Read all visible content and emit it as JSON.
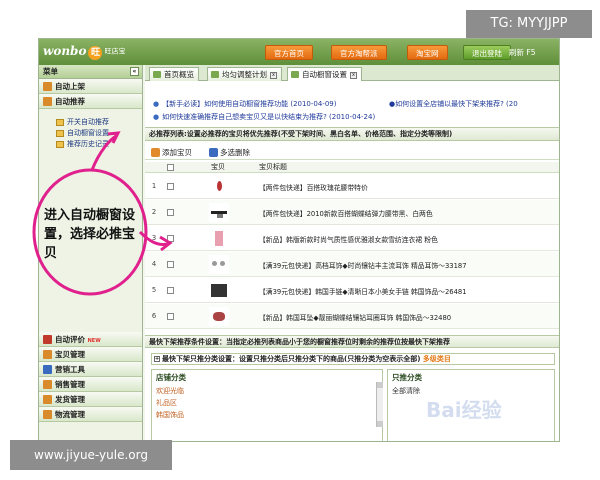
{
  "watermarks": {
    "tg": "TG: MYYJJPP",
    "site": "www.jiyue-yule.org",
    "baidu": "Bai经验"
  },
  "logo": {
    "text": "wonbo",
    "mark": "旺",
    "sub": "旺店宝"
  },
  "topnav": [
    "官方首页",
    "官方淘帮派",
    "淘宝网",
    "退出登陆"
  ],
  "refresh": "刷新 F5",
  "sidebar": {
    "header": "菜单",
    "collapse": "«",
    "groups_top": [
      "自动上架",
      "自动推荐"
    ],
    "subitems": [
      "开关自动推荐",
      "自动橱窗设置",
      "推荐历史记录"
    ],
    "groups_bottom": [
      "自动评价",
      "宝贝管理",
      "营销工具",
      "销售管理",
      "发货管理",
      "物流管理"
    ],
    "new_badge": "NEW"
  },
  "tabs": [
    {
      "label": "首页概览"
    },
    {
      "label": "均匀调整计划"
    },
    {
      "label": "自动橱窗设置"
    }
  ],
  "notices": [
    "【新手必读】如何使用自动橱窗推荐功能 (2010-04-09)",
    "如何快速准确推荐自己想卖宝贝又是以快结束为推荐? (2010-04-24)"
  ],
  "notice_right": "如何设置全店铺以最快下架来推荐? (20",
  "section_title": "必推荐列表:设置必推荐的宝贝将优先推荐(不受下架时间、黑白名单、价格范围、指定分类等限制)",
  "toolbar": {
    "add": "添加宝贝",
    "delete": "多选删除"
  },
  "table": {
    "headers": {
      "item": "宝贝",
      "title": "宝贝标题"
    },
    "rows": [
      {
        "num": "1",
        "title": "【两件包快递】百搭玫瑰花腰带特价"
      },
      {
        "num": "2",
        "title": "【两件包快递】2010新款百搭蝴蝶结弹力腰带黑、白两色"
      },
      {
        "num": "3",
        "title": "【新品】韩版新款时尚气质性感优雅淑女款雪纺连衣裙 粉色"
      },
      {
        "num": "4",
        "title": "【满39元包快递】高档耳饰◆时尚镶钻丰主流耳饰 精品耳饰～33187"
      },
      {
        "num": "5",
        "title": "【满39元包快递】韩国手链◆清晰日本小美女手链 韩国饰品～26481"
      },
      {
        "num": "6",
        "title": "【新品】韩国耳坠◆靓丽蝴蝶结镶钻耳圈耳饰 韩国饰品～32480"
      }
    ]
  },
  "lower_bar": "最快下架推荐条件设置：当指定必推列表商品小于您的橱窗推荐位时剩余的推荐位按最快下架推荐",
  "lower_sub": {
    "text": "最快下架只推分类设置：设置只推分类后只推分类下的商品(只推分类为空表示全部)",
    "more": "多级类目"
  },
  "panels": {
    "left": {
      "title": "店铺分类",
      "items": [
        "欢迎光临",
        "礼品区",
        "韩国饰品"
      ]
    },
    "right": {
      "title": "只推分类",
      "items": [
        "全部清除"
      ]
    }
  },
  "annotation": "进入自动橱窗设置，选择必推宝贝"
}
